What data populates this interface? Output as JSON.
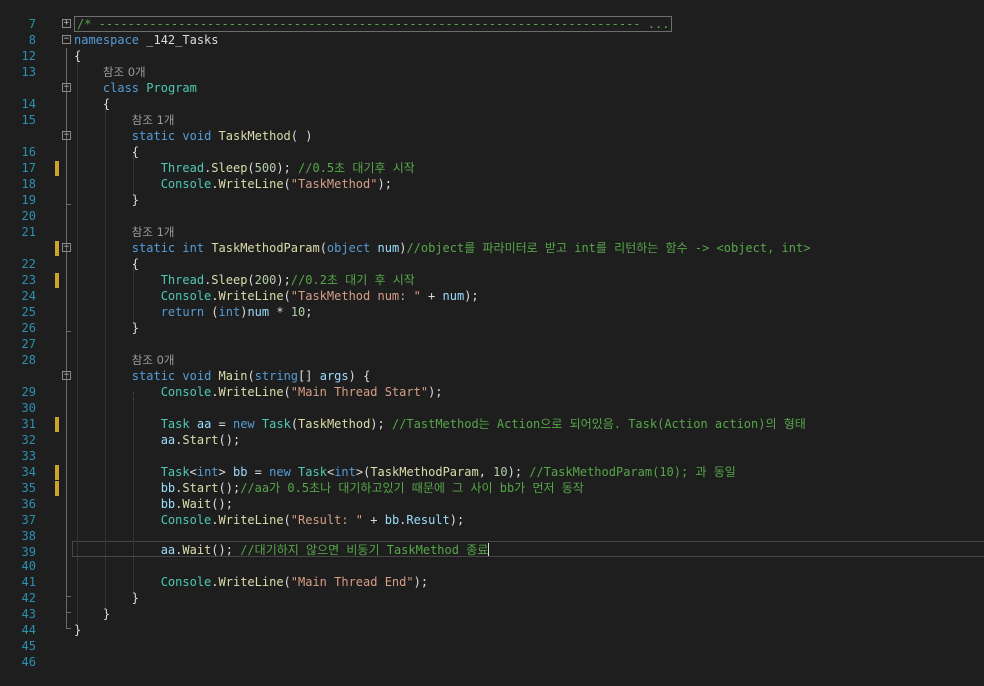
{
  "code_lines": [
    {
      "line": "7"
    },
    {
      "line": "8",
      "comment_block": "/* --------------------------------------------------------------------------- ..."
    },
    {
      "line": "12",
      "kw": "namespace",
      "name": " _142_Tasks"
    },
    {
      "line": "13",
      "brace": "{"
    },
    {
      "line": "14",
      "lens": "참조 0개",
      "kw": "class",
      "type": "Program"
    },
    {
      "line": "15",
      "brace": "{"
    },
    {
      "line": "16",
      "lens": "참조 1개",
      "kw1": "static",
      "kw2": "void",
      "method": "TaskMethod",
      "params": "( )"
    },
    {
      "line": "17",
      "brace": "{"
    },
    {
      "line": "18",
      "t": "Thread",
      "m": "Sleep",
      "n": "500",
      "c": " //0.5초 대기후 시작"
    },
    {
      "line": "19",
      "t": "Console",
      "m": "WriteLine",
      "s": "\"TaskMethod\""
    },
    {
      "line": "20",
      "brace": "}"
    },
    {
      "line": "21"
    },
    {
      "line": "22",
      "lens": "참조 1개",
      "kw1": "static",
      "kw2": "int",
      "method": "TaskMethodParam",
      "pkw": "object",
      "pname": "num",
      "c": "//object를 파라미터로 받고 int를 리턴하는 함수 -> <object, int>"
    },
    {
      "line": "23",
      "brace": "{"
    },
    {
      "line": "24",
      "t": "Thread",
      "m": "Sleep",
      "n": "200",
      "c": "//0.2초 대기 후 시작"
    },
    {
      "line": "25",
      "t": "Console",
      "m": "WriteLine",
      "s": "\"TaskMethod num: \"",
      "rest": " + ",
      "p": "num"
    },
    {
      "line": "26",
      "kw": "return",
      "cast": "int",
      "p": "num",
      "rest": " * ",
      "n": "10"
    },
    {
      "line": "27",
      "brace": "}"
    },
    {
      "line": "28"
    },
    {
      "line": "29",
      "lens": "참조 0개",
      "kw1": "static",
      "kw2": "void",
      "method": "Main",
      "pkw": "string",
      "pname": "args",
      "brace": " {"
    },
    {
      "line": "30",
      "t": "Console",
      "m": "WriteLine",
      "s": "\"Main Thread Start\""
    },
    {
      "line": "31"
    },
    {
      "line": "32",
      "t": "Task",
      "p": "aa",
      "kw": "new",
      "t2": "Task",
      "m": "TaskMethod",
      "c": " //TastMethod는 Action으로 되어있음. Task(Action action)의 형태"
    },
    {
      "line": "33",
      "p": "aa",
      "m": "Start"
    },
    {
      "line": "34"
    },
    {
      "line": "35",
      "t": "Task",
      "kw": "int",
      "p": "bb",
      "m": "TaskMethodParam",
      "n": "10",
      "c": " //TaskMethodParam(10); 과 동일"
    },
    {
      "line": "36",
      "p": "bb",
      "m": "Start",
      "c": "//aa가 0.5초나 대기하고있기 때문에 그 사이 bb가 먼저 동작"
    },
    {
      "line": "37",
      "p": "bb",
      "m": "Wait"
    },
    {
      "line": "38",
      "t": "Console",
      "m": "WriteLine",
      "s": "\"Result: \"",
      "p": "bb",
      "prop": "Result"
    },
    {
      "line": "39"
    },
    {
      "line": "40",
      "p": "aa",
      "m": "Wait",
      "c": " //대기하지 않으면 비동기 TaskMethod 종료"
    },
    {
      "line": "41"
    },
    {
      "line": "42",
      "t": "Console",
      "m": "WriteLine",
      "s": "\"Main Thread End\""
    },
    {
      "line": "43",
      "brace": "}"
    },
    {
      "line": "44",
      "brace": "}"
    },
    {
      "line": "45",
      "brace": "}"
    },
    {
      "line": "46"
    }
  ],
  "colors": {
    "background": "#1e1e1e",
    "line_number": "#2b91af",
    "keyword": "#569cd6",
    "type": "#4ec9b0",
    "method": "#dcdcaa",
    "string": "#d69d85",
    "comment": "#57a64a",
    "identifier": "#9cdcfe",
    "number": "#b5cea8",
    "change_marker": "#c9a52d"
  }
}
